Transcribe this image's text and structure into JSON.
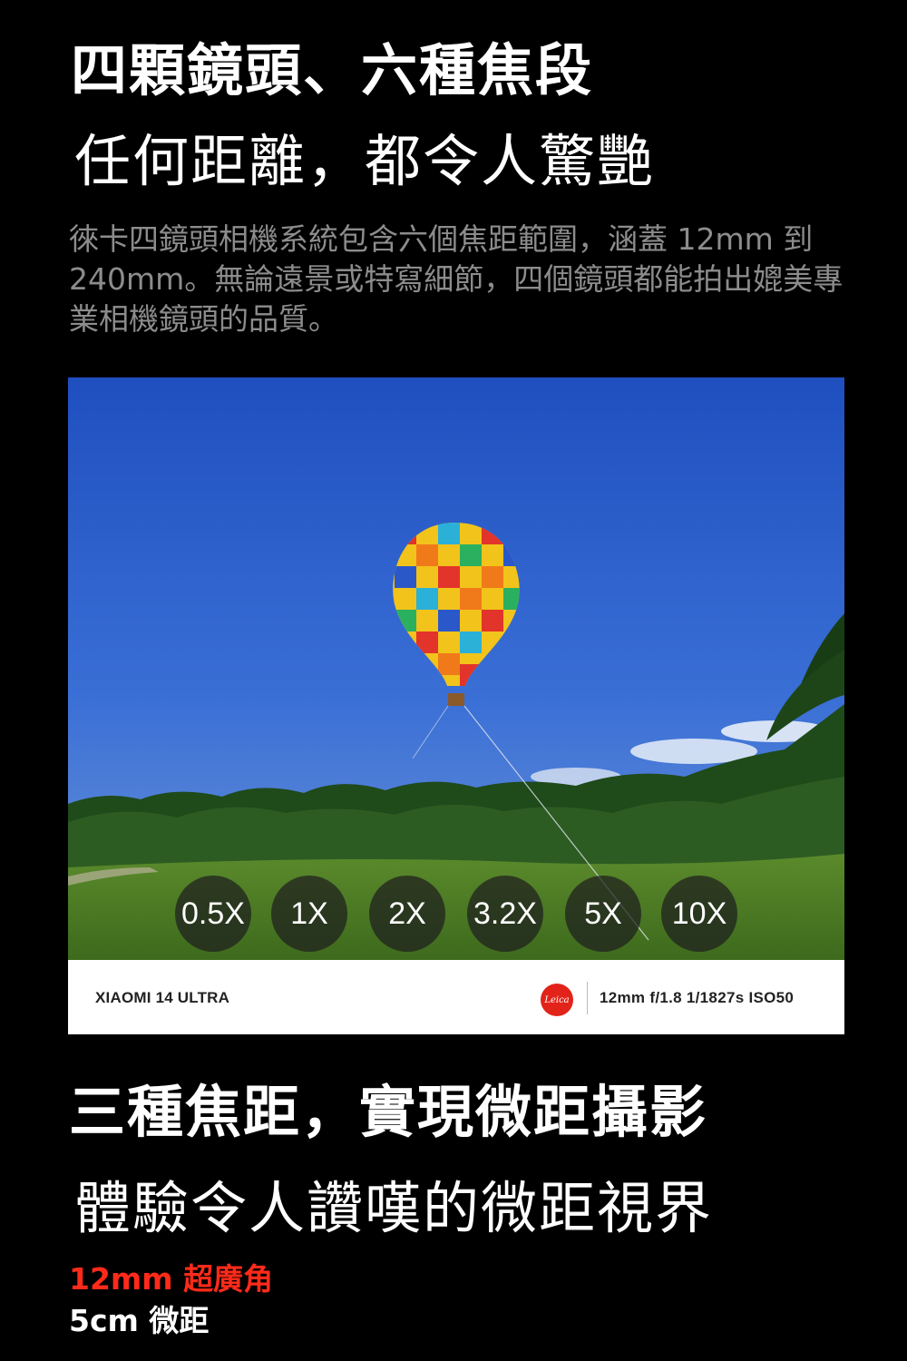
{
  "section1": {
    "headline": "四顆鏡頭、六種焦段",
    "subheadline": "任何距離，都令人驚艷",
    "description": "徠卡四鏡頭相機系統包含六個焦距範圍，涵蓋 12mm 到 240mm。無論遠景或特寫細節，四個鏡頭都能拍出媲美專業相機鏡頭的品質。"
  },
  "photo": {
    "zoom_levels": [
      "0.5X",
      "1X",
      "2X",
      "3.2X",
      "5X",
      "10X"
    ],
    "selected_zoom": "0.5X",
    "info_bar": {
      "model": "XIAOMI 14 ULTRA",
      "brand_logo": "Leica",
      "params": "12mm  f/1.8  1/1827s  ISO50"
    }
  },
  "section2": {
    "headline": "三種焦距，實現微距攝影",
    "subheadline": "體驗令人讚嘆的微距視界",
    "spec_red": "12mm 超廣角",
    "spec_white": "5cm 微距"
  },
  "colors": {
    "accent_red": "#ff2a1a",
    "leica_red": "#e2231a",
    "background": "#000000",
    "description_gray": "#8c8c8c"
  }
}
